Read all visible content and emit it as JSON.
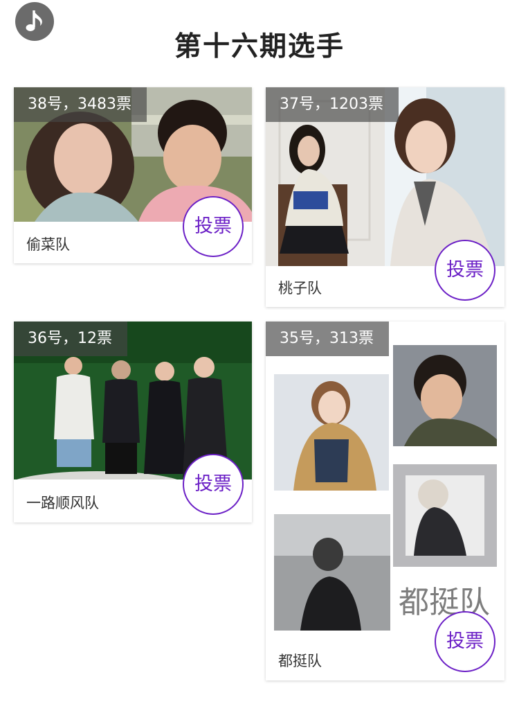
{
  "header": {
    "music_icon": "music-note-icon",
    "title": "第十六期选手"
  },
  "contestants": [
    {
      "tag": "38号，3483票",
      "team": "偷菜队",
      "vote": "投票"
    },
    {
      "tag": "37号，1203票",
      "team": "桃子队",
      "vote": "投票"
    },
    {
      "tag": "36号，12票",
      "team": "一路顺风队",
      "vote": "投票"
    },
    {
      "tag": "35号，313票",
      "team": "都挺队",
      "vote": "投票",
      "photo_caption": "都挺队"
    }
  ],
  "colors": {
    "accent": "#6b1fc6",
    "tag_bg": "#464646"
  }
}
